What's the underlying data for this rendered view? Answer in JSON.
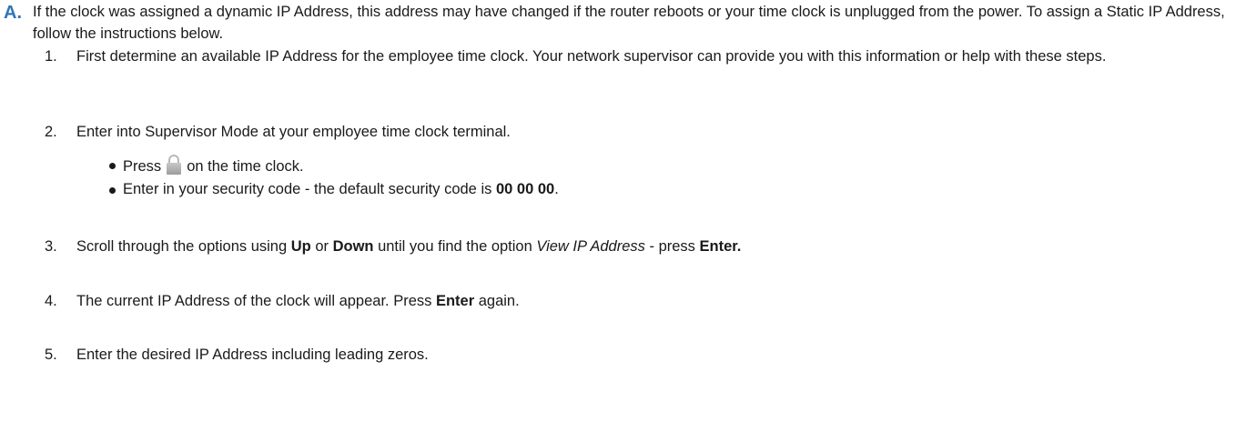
{
  "section": {
    "marker": "A.",
    "intro": "If the clock was assigned a dynamic IP Address, this address may have changed if the router reboots or your time clock is unplugged from the power.  To assign a Static IP Address, follow the instructions below."
  },
  "steps": [
    {
      "num": "1.",
      "text": "First determine an available IP Address for the employee time clock. Your network supervisor can provide you with this information or help with these steps."
    },
    {
      "num": "2.",
      "text": "Enter into Supervisor Mode at your employee time clock terminal.",
      "sub": [
        {
          "before": "Press",
          "icon": "lock-icon",
          "after": "on the time clock."
        },
        {
          "before": "Enter in your security code - the default security code is ",
          "bold": "00 00 00",
          "after": "."
        }
      ]
    },
    {
      "num": "3.",
      "parts": {
        "t1": "Scroll through the options using ",
        "b1": "Up",
        "t2": " or ",
        "b2": "Down",
        "t3": " until you find the option ",
        "i1": "View IP Address",
        "t4": " - press ",
        "b3": "Enter."
      }
    },
    {
      "num": "4.",
      "parts": {
        "t1": "The current IP Address of the clock will appear. Press ",
        "b1": "Enter",
        "t2": " again."
      }
    },
    {
      "num": "5.",
      "text": "Enter the desired IP Address including leading zeros."
    }
  ]
}
